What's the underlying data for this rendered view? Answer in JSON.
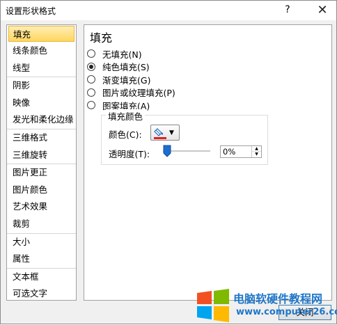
{
  "window": {
    "title": "设置形状格式",
    "help_label": "?",
    "close_label": "✕"
  },
  "sidebar": {
    "groups": [
      [
        "填充",
        "线条颜色",
        "线型"
      ],
      [
        "阴影",
        "映像",
        "发光和柔化边缘"
      ],
      [
        "三维格式",
        "三维旋转"
      ],
      [
        "图片更正",
        "图片颜色",
        "艺术效果",
        "裁剪"
      ],
      [
        "大小",
        "属性"
      ],
      [
        "文本框",
        "可选文字"
      ]
    ],
    "selected": "填充"
  },
  "panel": {
    "title": "填充",
    "options": [
      {
        "label": "无填充(N)",
        "checked": false
      },
      {
        "label": "纯色填充(S)",
        "checked": true
      },
      {
        "label": "渐变填充(G)",
        "checked": false
      },
      {
        "label": "图片或纹理填充(P)",
        "checked": false
      },
      {
        "label": "图案填充(A)",
        "checked": false
      }
    ],
    "fill_color": {
      "legend": "填充颜色",
      "color_label": "颜色(C):",
      "color_icon": "paint-bucket-icon",
      "color_swatch": "#e02020",
      "transparency_label": "透明度(T):",
      "transparency_value": "0%",
      "transparency_fraction": 0
    }
  },
  "footer": {
    "close_button": "关闭"
  },
  "watermark": {
    "text": "电脑软硬件教程网",
    "url": "www.computer26.com"
  },
  "colors": {
    "accent": "#1f77c9",
    "selection": "#ffd75e",
    "slider_thumb": "#1c6fd0"
  }
}
